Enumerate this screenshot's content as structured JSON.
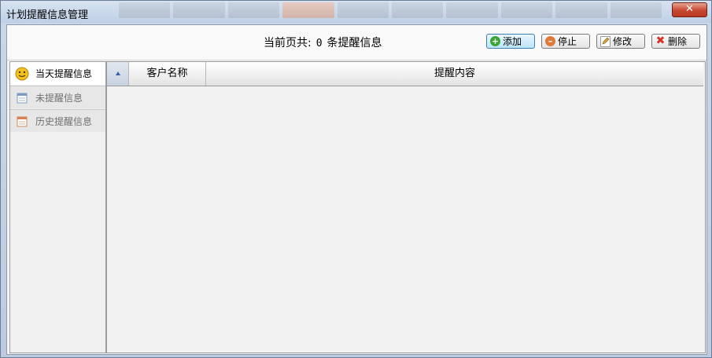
{
  "window": {
    "title": "计划提醒信息管理",
    "close_glyph": "✕"
  },
  "toolbar": {
    "page_info_prefix": "当前页共:",
    "page_count": "0",
    "page_info_suffix": "条提醒信息",
    "buttons": [
      {
        "label": "添加",
        "icon": "add-icon",
        "color": "#3aa335"
      },
      {
        "label": "停止",
        "icon": "stop-icon",
        "color": "#e07a3a"
      },
      {
        "label": "修改",
        "icon": "edit-icon",
        "color": "#d9a33a"
      },
      {
        "label": "删除",
        "icon": "delete-icon",
        "color": "#d8312c"
      }
    ]
  },
  "sidebar": {
    "items": [
      {
        "label": "当天提醒信息",
        "icon": "smiley-clock-icon",
        "state": "active"
      },
      {
        "label": "未提醒信息",
        "icon": "calendar-icon",
        "state": "inactive"
      },
      {
        "label": "历史提醒信息",
        "icon": "calendar-history-icon",
        "state": "inactive"
      }
    ]
  },
  "grid": {
    "sort_icon": "sort-icon",
    "columns": [
      "客户名称",
      "提醒内容"
    ],
    "rows": []
  },
  "colors": {
    "titlebar": "#c9d7e8",
    "close_button": "#c7462f",
    "primary_button": "#bde5fa",
    "sidebar_active": "#ffffff"
  }
}
